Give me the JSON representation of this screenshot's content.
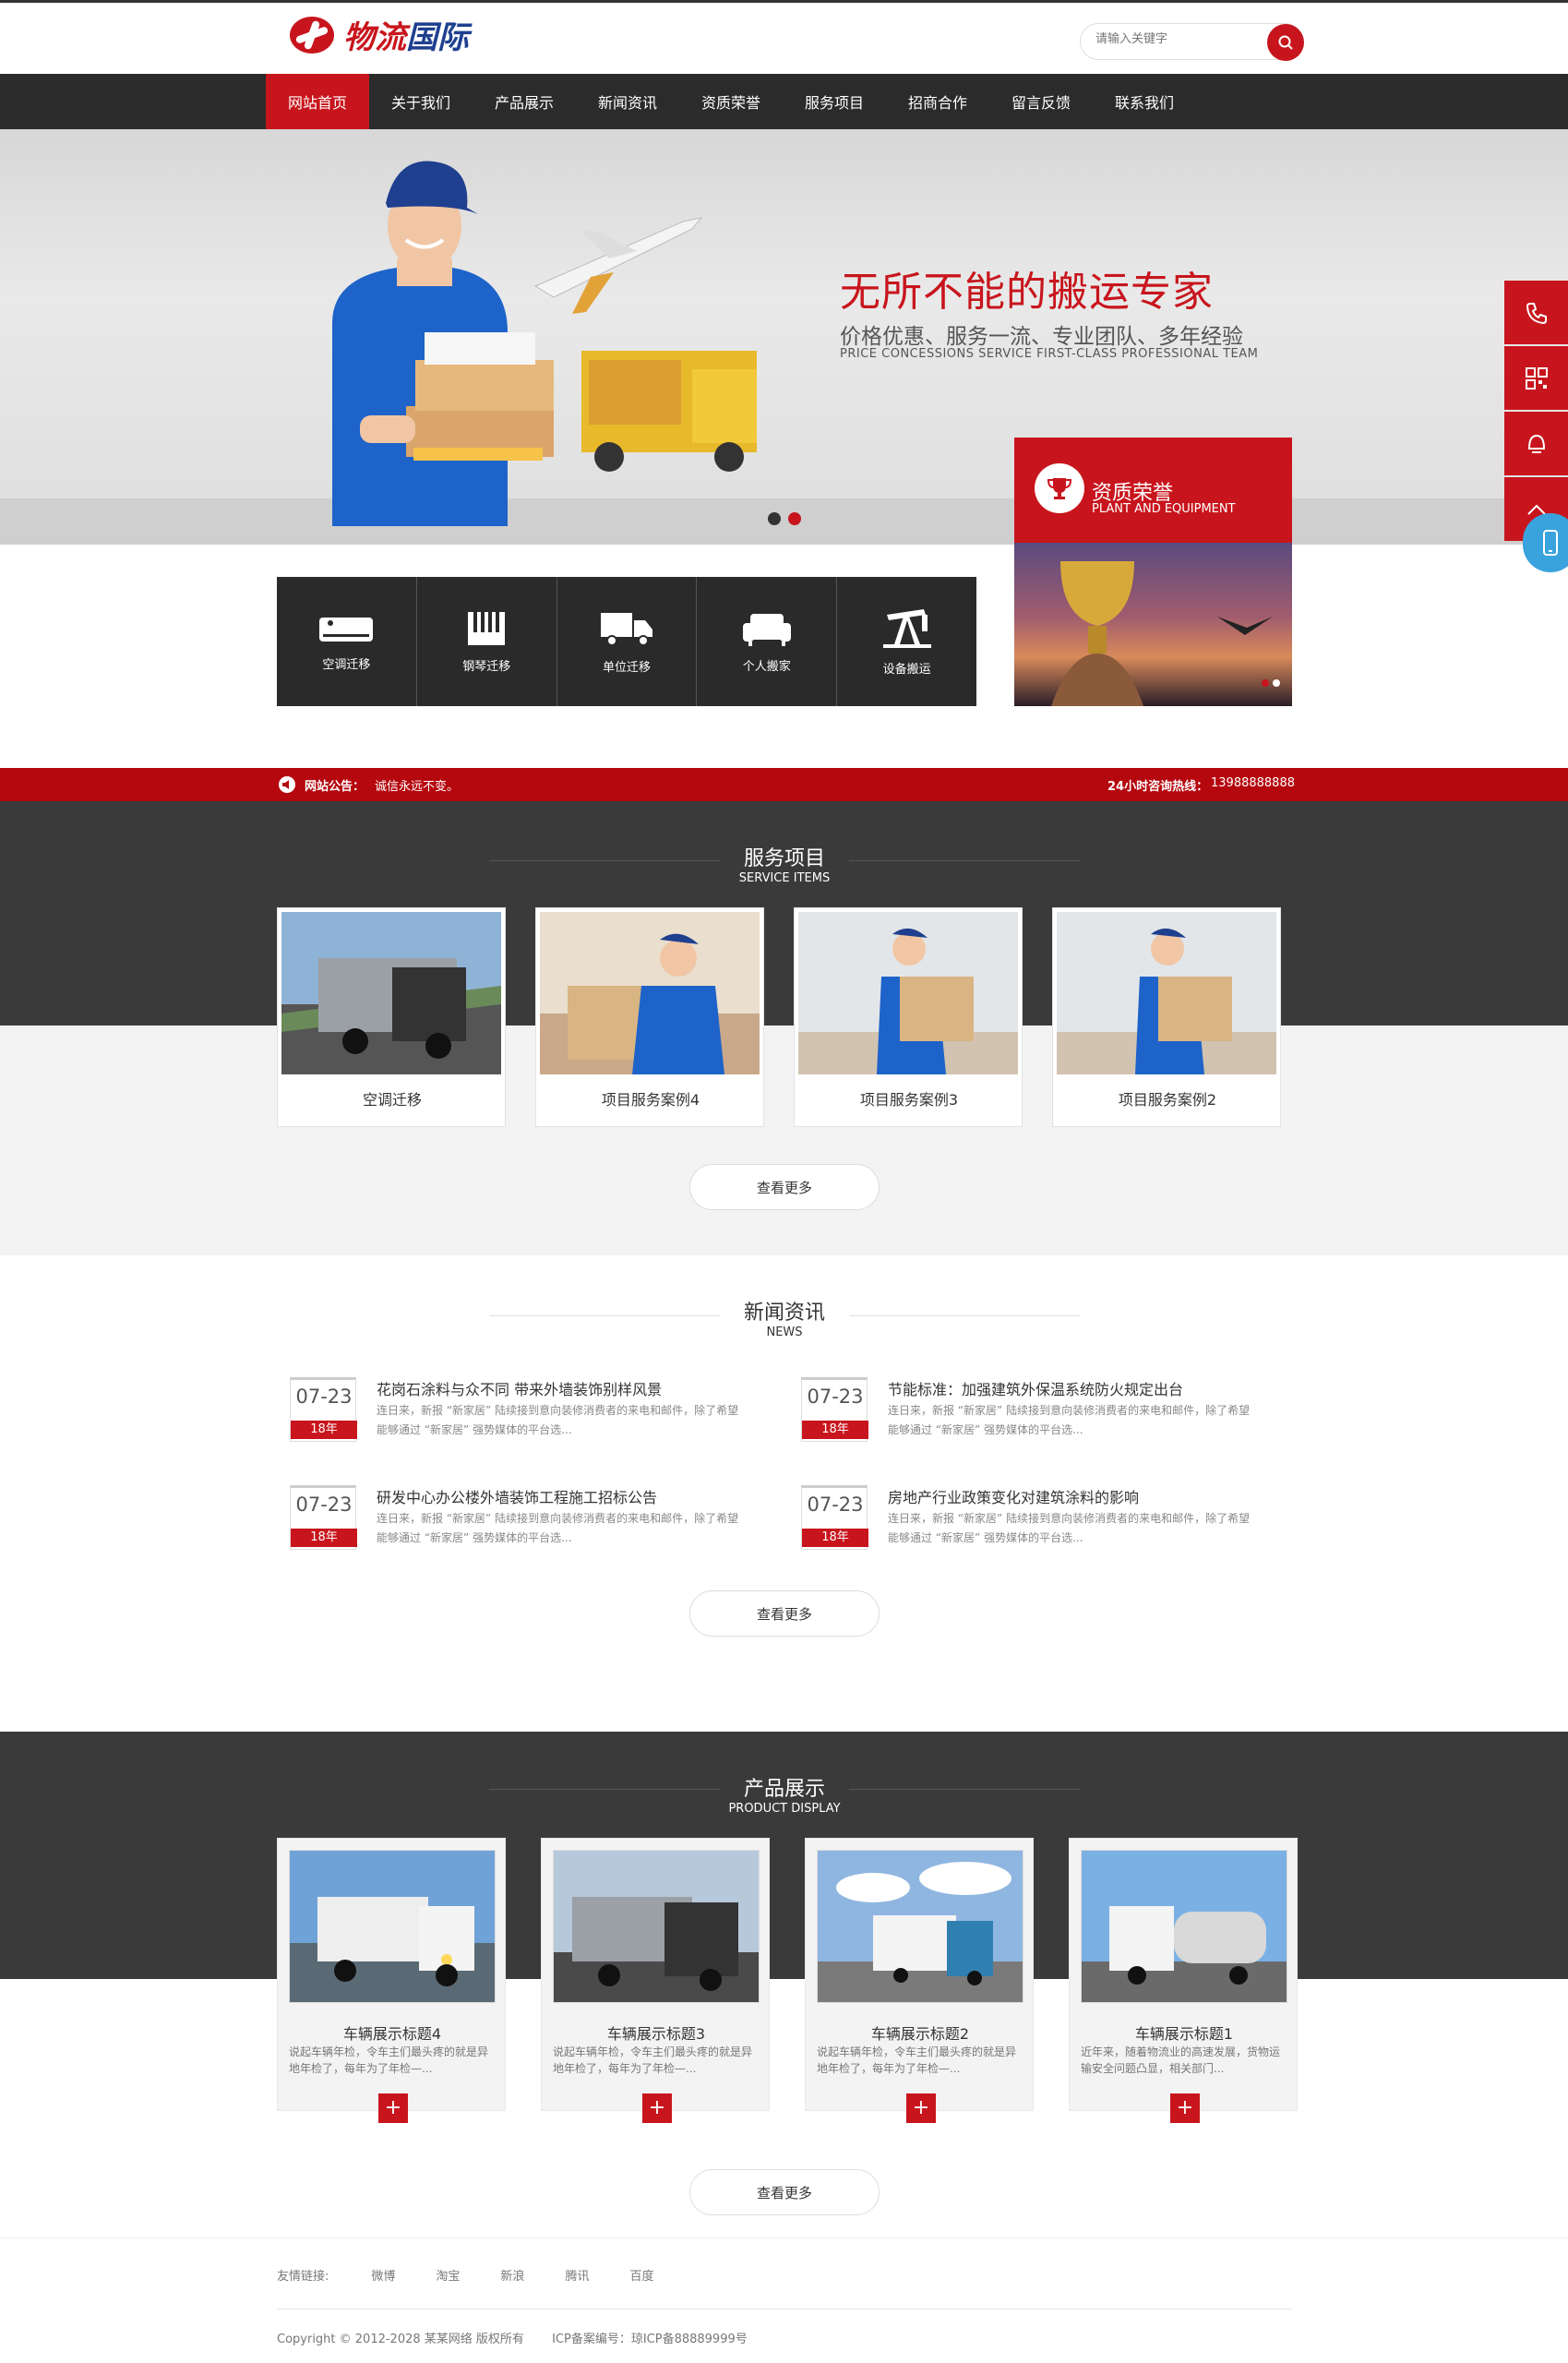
{
  "header": {
    "logo_text_red": "物流",
    "logo_text_blue": "国际",
    "search_placeholder": "请输入关键字"
  },
  "nav": {
    "items": [
      {
        "label": "网站首页",
        "active": true
      },
      {
        "label": "关于我们"
      },
      {
        "label": "产品展示"
      },
      {
        "label": "新闻资讯"
      },
      {
        "label": "资质荣誉"
      },
      {
        "label": "服务项目"
      },
      {
        "label": "招商合作"
      },
      {
        "label": "留言反馈"
      },
      {
        "label": "联系我们"
      }
    ]
  },
  "banner": {
    "title": "无所不能的搬运专家",
    "subtitle": "价格优惠、服务一流、专业团队、多年经验",
    "subtitle_en": "PRICE CONCESSIONS  SERVICE FIRST-CLASS  PROFESSIONAL TEAM"
  },
  "tiles": [
    {
      "label": "空调迁移",
      "icon": "air-conditioner-icon"
    },
    {
      "label": "钢琴迁移",
      "icon": "piano-icon"
    },
    {
      "label": "单位迁移",
      "icon": "truck-icon"
    },
    {
      "label": "个人搬家",
      "icon": "sofa-icon"
    },
    {
      "label": "设备搬运",
      "icon": "oil-pump-icon"
    }
  ],
  "honor": {
    "title": "资质荣誉",
    "subtitle": "PLANT AND EQUIPMENT"
  },
  "notice": {
    "label": "网站公告：",
    "text": "诚信永远不变。",
    "hotline_label": "24小时咨询热线：",
    "hotline": "13988888888"
  },
  "services": {
    "title": "服务项目",
    "title_en": "SERVICE ITEMS",
    "items": [
      "空调迁移",
      "项目服务案例4",
      "项目服务案例3",
      "项目服务案例2"
    ],
    "more": "查看更多"
  },
  "news": {
    "title": "新闻资讯",
    "title_en": "NEWS",
    "items": [
      {
        "md": "07-23",
        "yr": "18年",
        "title": "花岗石涂料与众不同 带来外墙装饰别样风景",
        "desc": "连日来，新报 “新家居” 陆续接到意向装修消费者的来电和邮件，除了希望能够通过 “新家居” 强势媒体的平台选..."
      },
      {
        "md": "07-23",
        "yr": "18年",
        "title": "节能标准：加强建筑外保温系统防火规定出台",
        "desc": "连日来，新报 “新家居” 陆续接到意向装修消费者的来电和邮件，除了希望能够通过 “新家居” 强势媒体的平台选..."
      },
      {
        "md": "07-23",
        "yr": "18年",
        "title": "研发中心办公楼外墙装饰工程施工招标公告",
        "desc": "连日来，新报 “新家居” 陆续接到意向装修消费者的来电和邮件，除了希望能够通过 “新家居” 强势媒体的平台选..."
      },
      {
        "md": "07-23",
        "yr": "18年",
        "title": "房地产行业政策变化对建筑涂料的影响",
        "desc": "连日来，新报 “新家居” 陆续接到意向装修消费者的来电和邮件，除了希望能够通过 “新家居” 强势媒体的平台选..."
      }
    ],
    "more": "查看更多"
  },
  "products": {
    "title": "产品展示",
    "title_en": "PRODUCT DISPLAY",
    "items": [
      {
        "title": "车辆展示标题4",
        "desc": "说起车辆年检，令车主们最头疼的就是异地年检了，每年为了年检—..."
      },
      {
        "title": "车辆展示标题3",
        "desc": "说起车辆年检，令车主们最头疼的就是异地年检了，每年为了年检—..."
      },
      {
        "title": "车辆展示标题2",
        "desc": "说起车辆年检，令车主们最头疼的就是异地年检了，每年为了年检—..."
      },
      {
        "title": "车辆展示标题1",
        "desc": "近年来，随着物流业的高速发展，货物运输安全问题凸显，相关部门..."
      }
    ],
    "more": "查看更多",
    "plus": "+"
  },
  "footer": {
    "links_label": "友情链接:",
    "links": [
      "微博",
      "淘宝",
      "新浪",
      "腾讯",
      "百度"
    ],
    "copyright": "Copyright © 2012-2028 某某网络 版权所有",
    "icp": "ICP备案编号：琼ICP备88889999号"
  },
  "colors": {
    "brand_red": "#c8151d",
    "dark": "#2b2b2b",
    "notice_red": "#b5070e"
  }
}
